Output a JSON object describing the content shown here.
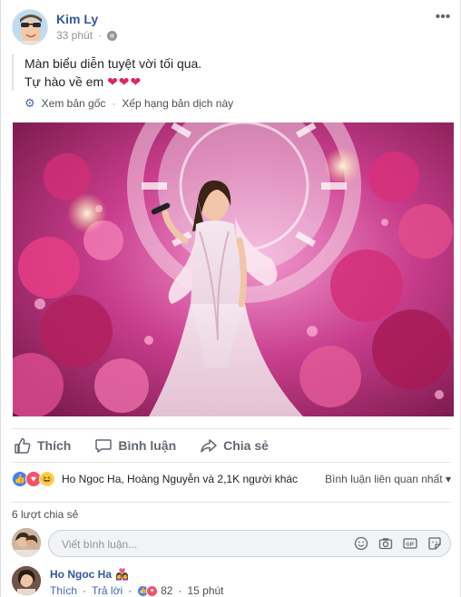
{
  "post": {
    "author": "Kim Ly",
    "time": "33 phút",
    "caption_line1": "Màn biểu diễn tuyệt vời tối qua.",
    "caption_line2": "Tự hào về em",
    "caption_hearts": "❤❤❤",
    "translate_original": "Xem bản gốc",
    "translate_rate": "Xếp hạng bản dịch này"
  },
  "actions": {
    "like": "Thích",
    "comment": "Bình luận",
    "share": "Chia sẻ"
  },
  "reactions": {
    "summary": "Ho Ngoc Ha, Hoàng Nguyễn và 2,1K người khác",
    "sort_label": "Bình luận liên quan nhất"
  },
  "shares": {
    "count_text": "6 lượt chia sẻ"
  },
  "compose": {
    "placeholder": "Viết bình luận..."
  },
  "comment": {
    "author": "Ho Ngoc Ha",
    "emoji": "👩‍❤️‍👩",
    "like": "Thích",
    "reply": "Trả lời",
    "reaction_count": "82",
    "time": "15 phút"
  },
  "colors": {
    "link_blue": "#365899",
    "accent_blue": "#4267b2",
    "heart_red": "#e0245e"
  }
}
